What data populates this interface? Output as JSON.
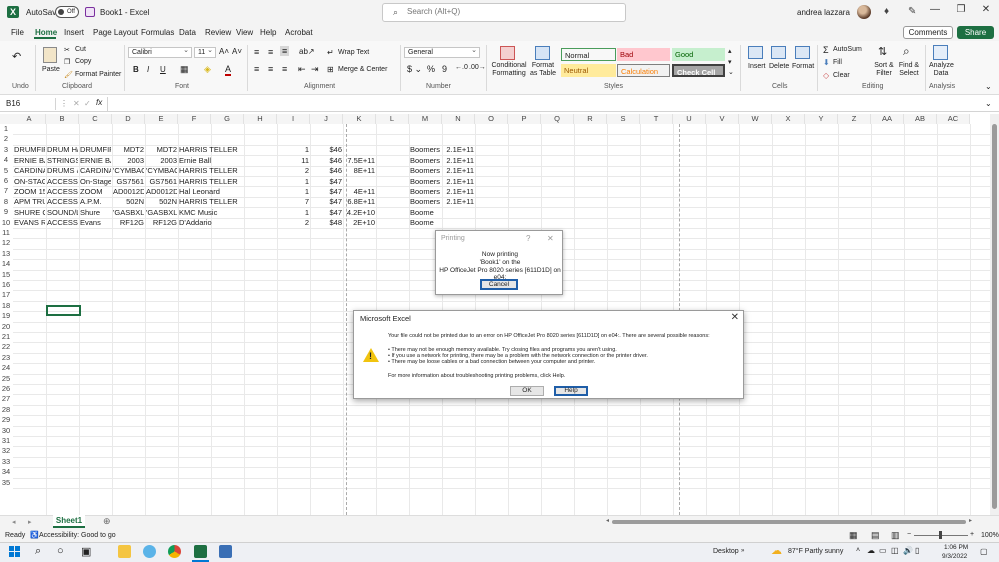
{
  "titlebar": {
    "autosave_label": "AutoSave",
    "autosave_state": "Off",
    "doc_title": "Book1 - Excel",
    "search_placeholder": "Search (Alt+Q)",
    "user_name": "andrea lazzara"
  },
  "menu": {
    "items": [
      "File",
      "Home",
      "Insert",
      "Page Layout",
      "Formulas",
      "Data",
      "Review",
      "View",
      "Help",
      "Acrobat"
    ],
    "comments_label": "Comments",
    "share_label": "Share"
  },
  "ribbon": {
    "clipboard": {
      "paste": "Paste",
      "cut": "Cut",
      "copy": "Copy",
      "format_painter": "Format Painter",
      "label": "Clipboard"
    },
    "undo": {
      "label": "Undo"
    },
    "font": {
      "name": "Calibri",
      "size": "11",
      "label": "Font"
    },
    "alignment": {
      "wrap_text": "Wrap Text",
      "merge_center": "Merge & Center",
      "label": "Alignment"
    },
    "number": {
      "format": "General",
      "label": "Number"
    },
    "styles": {
      "conditional": "Conditional Formatting",
      "format_as_table": "Format as Table",
      "cells": [
        {
          "label": "Normal",
          "bg": "#ffffff",
          "fg": "#222222"
        },
        {
          "label": "Bad",
          "bg": "#ffc7ce",
          "fg": "#9c0006"
        },
        {
          "label": "Good",
          "bg": "#c6efce",
          "fg": "#006100"
        },
        {
          "label": "Neutral",
          "bg": "#ffeb9c",
          "fg": "#9c5700"
        },
        {
          "label": "Calculation",
          "bg": "#f2f2f2",
          "fg": "#fa7d00"
        },
        {
          "label": "Check Cell",
          "bg": "#a5a5a5",
          "fg": "#ffffff"
        }
      ],
      "label": "Styles"
    },
    "cells": {
      "insert": "Insert",
      "delete": "Delete",
      "format": "Format",
      "label": "Cells"
    },
    "editing": {
      "autosum": "AutoSum",
      "fill": "Fill",
      "clear": "Clear",
      "sort_filter": "Sort & Filter",
      "find_select": "Find & Select",
      "label": "Editing"
    },
    "analysis": {
      "analyze_data": "Analyze Data",
      "label": "Analysis"
    }
  },
  "formula_bar": {
    "name_box": "B16",
    "fx": "fx",
    "content": ""
  },
  "columns": [
    "A",
    "B",
    "C",
    "D",
    "E",
    "F",
    "G",
    "H",
    "I",
    "J",
    "K",
    "L",
    "M",
    "N",
    "O",
    "P",
    "Q",
    "R",
    "S",
    "T",
    "U",
    "V",
    "W",
    "X",
    "Y",
    "Z",
    "AA",
    "AB",
    "AC"
  ],
  "rows": [
    "1",
    "2",
    "3",
    "4",
    "5",
    "6",
    "7",
    "8",
    "9",
    "10",
    "11",
    "12",
    "13",
    "14",
    "15",
    "16",
    "17",
    "18",
    "19",
    "20",
    "21",
    "22",
    "23",
    "24",
    "25",
    "26",
    "27",
    "28",
    "29",
    "30",
    "31",
    "32",
    "33",
    "34",
    "35"
  ],
  "sheet_rows": [
    [
      "DRUMFIR",
      "DRUM H/",
      "DRUMFIR",
      "MDT2",
      "MDT2",
      "HARRIS TELLER",
      "1",
      "$46",
      "",
      "",
      "Boomers",
      "2.1E+11"
    ],
    [
      "ERNIE BA",
      "STRINGS",
      "ERNIE BA",
      "2003",
      "2003",
      "Ernie Ball",
      "11",
      "$46",
      "7.5E+11",
      "",
      "Boomers",
      "2.1E+11"
    ],
    [
      "CARDINA",
      "DRUMS &",
      "CARDINA",
      "'CYMBAG",
      "'CYMBAG",
      "HARRIS TELLER",
      "2",
      "$46",
      "8E+11",
      "",
      "Boomers",
      "2.1E+11"
    ],
    [
      "ON-STAG",
      "ACCESSO",
      "On-Stage",
      "GS7561",
      "GS7561",
      "HARRIS TELLER",
      "1",
      "$47",
      "",
      "",
      "Boomers",
      "2.1E+11"
    ],
    [
      "ZOOM 15",
      "ACCESSO",
      "ZOOM",
      "AD0012D",
      "AD0012D",
      "Hal Leonard",
      "1",
      "$47",
      "4E+11",
      "",
      "Boomers",
      "2.1E+11"
    ],
    [
      "APM TRU",
      "ACCESSO",
      "A.P.M.",
      "502N",
      "502N",
      "HARRIS TELLER",
      "7",
      "$47",
      "6.8E+11",
      "",
      "Boomers",
      "2.1E+11"
    ],
    [
      "SHURE C/",
      "SOUND/L",
      "Shure",
      "'GASBXLR",
      "'GASBXLR",
      "KMC Music",
      "1",
      "$47",
      "4.2E+10",
      "",
      "Boome",
      ""
    ],
    [
      "EVANS RE",
      "ACCESSO",
      "Evans",
      "RF12G",
      "RF12G",
      "D'Addario",
      "2",
      "$48",
      "2E+10",
      "",
      "Boome",
      ""
    ]
  ],
  "sheet_tab": "Sheet1",
  "status": {
    "ready": "Ready",
    "accessibility": "Accessibility: Good to go",
    "zoom": "100%"
  },
  "taskbar": {
    "desktop": "Desktop",
    "weather": "87°F  Partly sunny",
    "time": "1:06 PM",
    "date": "9/3/2022"
  },
  "print_dialog": {
    "title": "Printing",
    "help": "?",
    "line1": "Now printing",
    "line2": "'Book1'  on the",
    "line3": "HP OfficeJet Pro 8020 series [611D1D] on e04:",
    "cancel": "Cancel"
  },
  "error_dialog": {
    "title": "Microsoft Excel",
    "message": "Your file could not be printed due to an error on HP OfficeJet Pro 8020 series [611D1D] on e04:. There are several possible reasons:",
    "reasons": [
      "• There may not be enough memory available. Try closing files and programs you aren't using.",
      "• If you use a network for printing, there may be a problem with the network connection or the printer driver.",
      "• There may be loose cables or a bad connection between your computer and printer."
    ],
    "more_info": "For more information about troubleshooting printing problems, click Help.",
    "ok": "OK",
    "help": "Help"
  }
}
